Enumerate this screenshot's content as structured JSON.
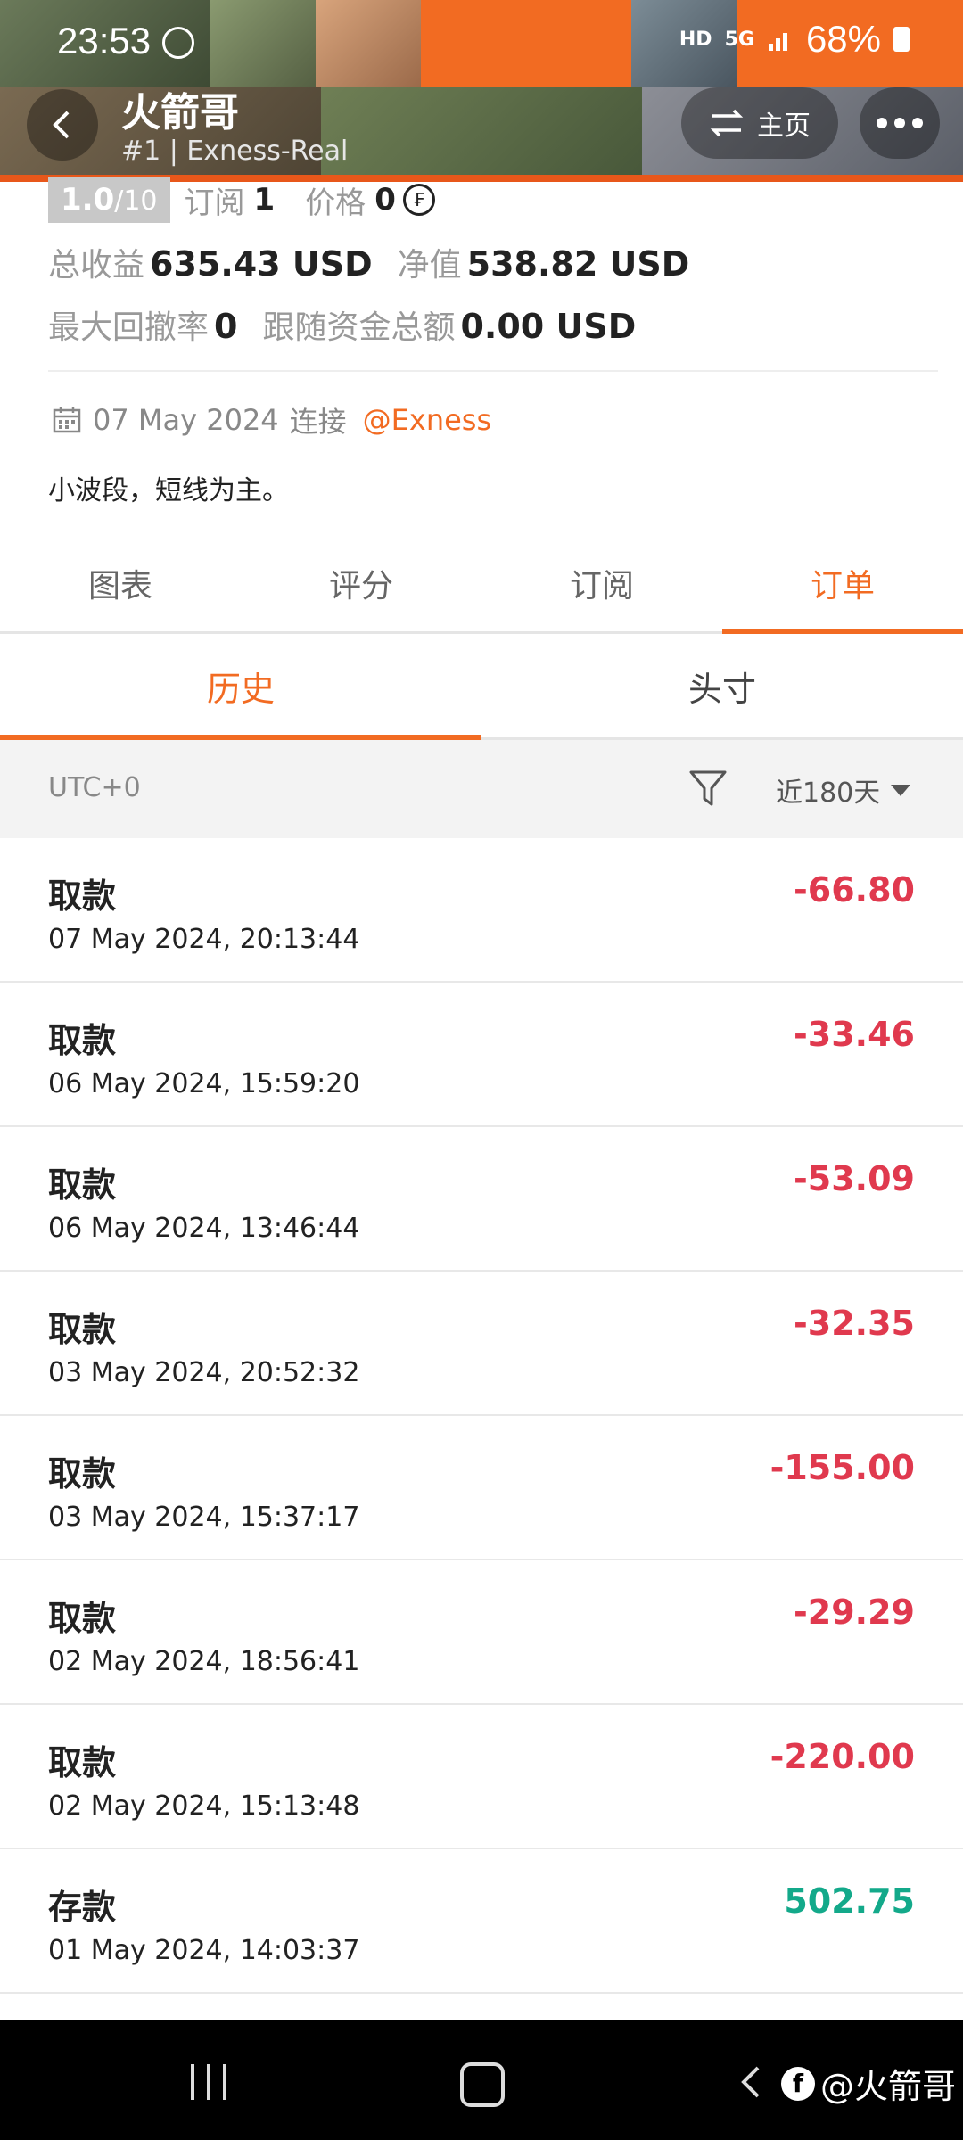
{
  "status": {
    "time": "23:53",
    "battery": "68%",
    "network": "5G",
    "hd": "HD"
  },
  "header": {
    "title": "火箭哥",
    "subtitle": "#1 | Exness-Real",
    "home_label": "主页"
  },
  "stats": {
    "rating_value": "1.0",
    "rating_max": "/10",
    "subscribe_label": "订阅",
    "subscribe_value": "1",
    "price_label": "价格",
    "price_value": "0",
    "total_profit_label": "总收益",
    "total_profit_value": "635.43 USD",
    "equity_label": "净值",
    "equity_value": "538.82 USD",
    "max_drawdown_label": "最大回撤率",
    "max_drawdown_value": "0",
    "follow_funds_label": "跟随资金总额",
    "follow_funds_value": "0.00 USD"
  },
  "connect": {
    "date": "07 May 2024",
    "text": "连接",
    "broker": "@Exness"
  },
  "description": "小波段，短线为主。",
  "tabs": [
    {
      "label": "图表"
    },
    {
      "label": "评分"
    },
    {
      "label": "订阅"
    },
    {
      "label": "订单"
    }
  ],
  "active_tab": "订单",
  "subtabs": [
    {
      "label": "历史"
    },
    {
      "label": "头寸"
    }
  ],
  "active_subtab": "历史",
  "filter": {
    "timezone": "UTC+0",
    "period": "近180天"
  },
  "transactions": [
    {
      "type": "取款",
      "datetime": "07 May 2024, 20:13:44",
      "amount": "-66.80"
    },
    {
      "type": "取款",
      "datetime": "06 May 2024, 15:59:20",
      "amount": "-33.46"
    },
    {
      "type": "取款",
      "datetime": "06 May 2024, 13:46:44",
      "amount": "-53.09"
    },
    {
      "type": "取款",
      "datetime": "03 May 2024, 20:52:32",
      "amount": "-32.35"
    },
    {
      "type": "取款",
      "datetime": "03 May 2024, 15:37:17",
      "amount": "-155.00"
    },
    {
      "type": "取款",
      "datetime": "02 May 2024, 18:56:41",
      "amount": "-29.29"
    },
    {
      "type": "取款",
      "datetime": "02 May 2024, 15:13:48",
      "amount": "-220.00"
    },
    {
      "type": "存款",
      "datetime": "01 May 2024, 14:03:37",
      "amount": "502.75"
    }
  ],
  "watermark": "@火箭哥",
  "colors": {
    "accent": "#f26b22",
    "negative": "#e0394e",
    "positive": "#13a98a"
  }
}
